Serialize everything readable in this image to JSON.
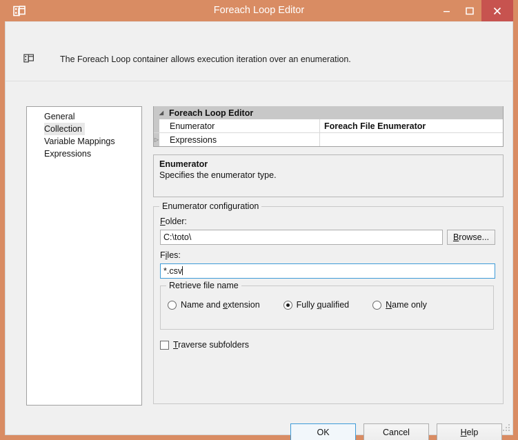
{
  "window": {
    "title": "Foreach Loop Editor",
    "icon": "foreach-loop-icon",
    "titlebar_color": "#d98c63",
    "close_button_color": "#c7534f",
    "controls": {
      "minimize": "–",
      "maximize": "☐",
      "close": "✕"
    }
  },
  "header": {
    "icon": "foreach-loop-icon",
    "description": "The Foreach Loop container allows execution iteration over an enumeration."
  },
  "sidebar": {
    "items": [
      {
        "label": "General",
        "selected": false
      },
      {
        "label": "Collection",
        "selected": true
      },
      {
        "label": "Variable Mappings",
        "selected": false
      },
      {
        "label": "Expressions",
        "selected": false
      }
    ]
  },
  "property_grid": {
    "category": "Foreach Loop Editor",
    "category_expanded_glyph": "◢",
    "rows": [
      {
        "name": "Enumerator",
        "value": "Foreach File Enumerator",
        "expander": ""
      },
      {
        "name": "Expressions",
        "value": "",
        "expander": "▷"
      }
    ]
  },
  "description_pane": {
    "title": "Enumerator",
    "body": "Specifies the enumerator type."
  },
  "enumerator_configuration": {
    "legend": "Enumerator configuration",
    "folder": {
      "label_prefix": "",
      "label_accel": "F",
      "label_suffix": "older:",
      "value": "C:\\toto\\"
    },
    "browse_button": {
      "accel": "B",
      "suffix": "rowse..."
    },
    "files": {
      "label_prefix": "F",
      "label_accel": "i",
      "label_suffix": "les:",
      "value": "*.csv",
      "focused": true
    },
    "retrieve_file_name": {
      "legend": "Retrieve file name",
      "options": [
        {
          "prefix": "Name and ",
          "accel": "e",
          "suffix": "xtension",
          "checked": false
        },
        {
          "prefix": "Fully ",
          "accel": "q",
          "suffix": "ualified",
          "checked": true
        },
        {
          "prefix": "",
          "accel": "N",
          "suffix": "ame only",
          "checked": false
        }
      ]
    },
    "traverse_subfolders": {
      "prefix": "",
      "accel": "T",
      "suffix": "raverse subfolders",
      "checked": false
    }
  },
  "footer": {
    "ok": {
      "prefix": "OK",
      "accel": "",
      "suffix": "",
      "focused": true
    },
    "cancel": {
      "prefix": "Cancel",
      "accel": "",
      "suffix": "",
      "focused": false
    },
    "help": {
      "prefix": "",
      "accel": "H",
      "suffix": "elp",
      "focused": false
    }
  }
}
